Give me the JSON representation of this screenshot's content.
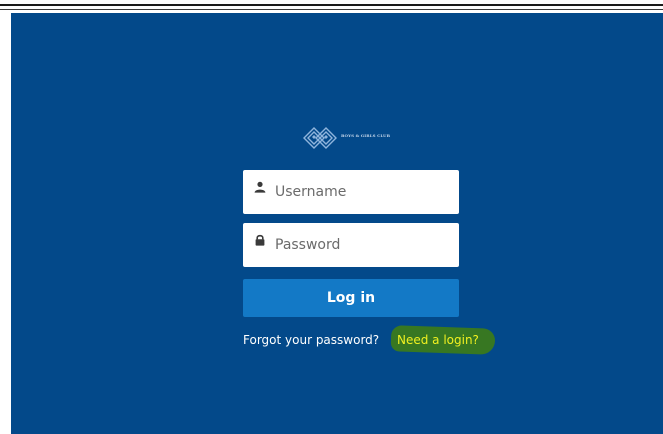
{
  "logo": {
    "text": "BOYS & GIRLS CLUB"
  },
  "login_form": {
    "username": {
      "placeholder": "Username",
      "value": ""
    },
    "password": {
      "placeholder": "Password",
      "value": ""
    },
    "login_button_label": "Log in"
  },
  "links": {
    "forgot_password": "Forgot your password?",
    "need_login": "Need a login?"
  },
  "colors": {
    "panel_background": "#03498a",
    "login_button": "#1379c6",
    "need_login_text": "#f0f020",
    "highlight_marker": "#3a7a1c"
  },
  "icons": {
    "username": "user-icon",
    "password": "lock-icon"
  }
}
